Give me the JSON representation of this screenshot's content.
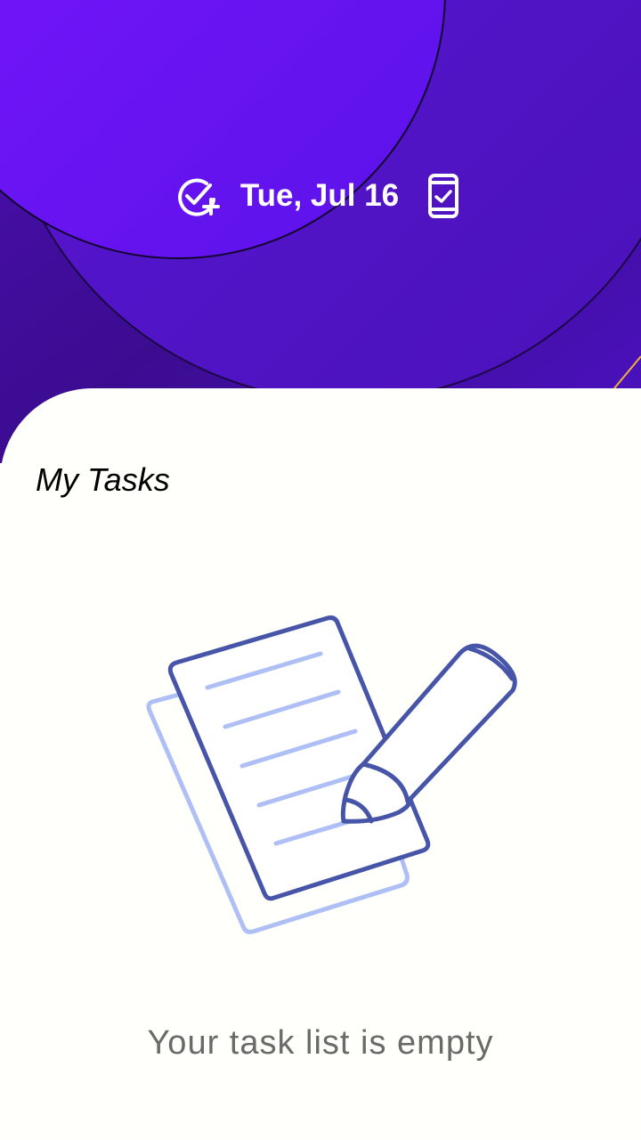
{
  "header": {
    "date": "Tue, Jul 16",
    "add_task_icon": "check-circle-plus-icon",
    "device_icon": "phone-check-icon",
    "colors": {
      "primary": "#6a14f0",
      "secondary": "#3a0d8a",
      "accent_line": "#f2b23a"
    }
  },
  "main": {
    "title": "My Tasks",
    "empty_state": {
      "illustration": "notepad-pencil-illustration",
      "message": "Your task list is empty"
    },
    "colors": {
      "card": "#fffffb",
      "illustration_dark": "#4655a8",
      "illustration_light": "#aebff5"
    }
  }
}
